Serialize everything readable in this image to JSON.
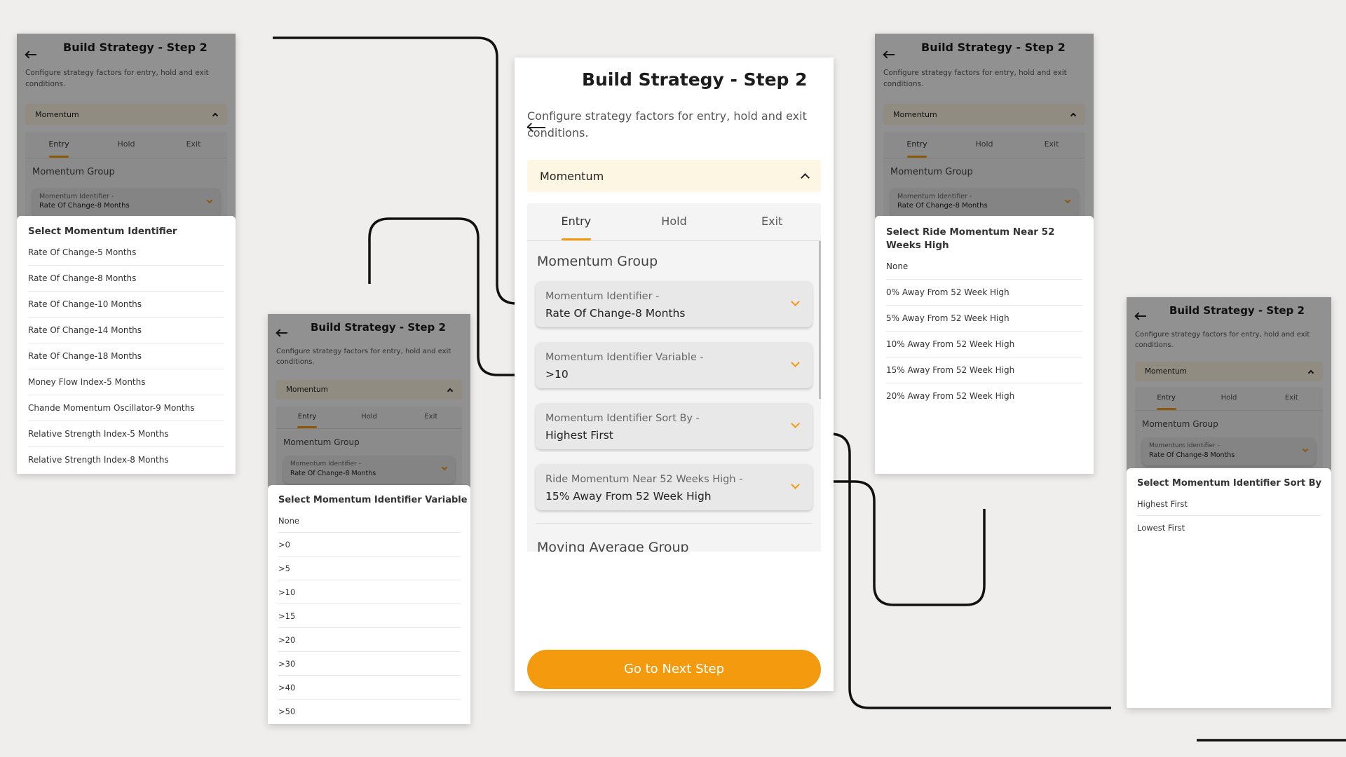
{
  "header": {
    "title": "Build Strategy - Step 2",
    "subtitle": "Configure strategy factors for entry, hold and exit conditions."
  },
  "accordion": {
    "label": "Momentum"
  },
  "tabs": [
    {
      "label": "Entry"
    },
    {
      "label": "Hold"
    },
    {
      "label": "Exit"
    }
  ],
  "group": {
    "title": "Momentum Group",
    "dropdowns": [
      {
        "label": "Momentum Identifier -",
        "value": "Rate Of Change-8 Months"
      },
      {
        "label": "Momentum Identifier Variable -",
        "value": ">10"
      },
      {
        "label": "Momentum Identifier Sort By -",
        "value": "Highest First"
      },
      {
        "label": "Ride Momentum Near 52 Weeks High -",
        "value": "15% Away From 52 Week High"
      }
    ],
    "next_group_title": "Moving Average Group"
  },
  "next_button": "Go to Next Step",
  "sheets": {
    "identifier": {
      "title": "Select Momentum Identifier",
      "options": [
        "Rate Of Change-5 Months",
        "Rate Of Change-8 Months",
        "Rate Of Change-10 Months",
        "Rate Of Change-14 Months",
        "Rate Of Change-18 Months",
        "Money Flow Index-5 Months",
        "Chande Momentum Oscillator-9 Months",
        "Relative Strength Index-5 Months",
        "Relative Strength Index-8 Months"
      ]
    },
    "variable": {
      "title": "Select Momentum Identifier Variable",
      "options": [
        "None",
        ">0",
        ">5",
        ">10",
        ">15",
        ">20",
        ">30",
        ">40",
        ">50"
      ]
    },
    "ride": {
      "title": "Select Ride Momentum Near 52 Weeks High",
      "options": [
        "None",
        "0% Away From 52 Week High",
        "5% Away From 52 Week High",
        "10% Away From 52 Week High",
        "15% Away From 52 Week High",
        "20% Away From 52 Week High"
      ]
    },
    "sort": {
      "title": "Select Momentum Identifier Sort By",
      "options": [
        "Highest First",
        "Lowest First"
      ]
    }
  },
  "colors": {
    "accent": "#f49a0f",
    "accordion_bg": "#fdf6e3",
    "page_bg": "#efeeec"
  }
}
